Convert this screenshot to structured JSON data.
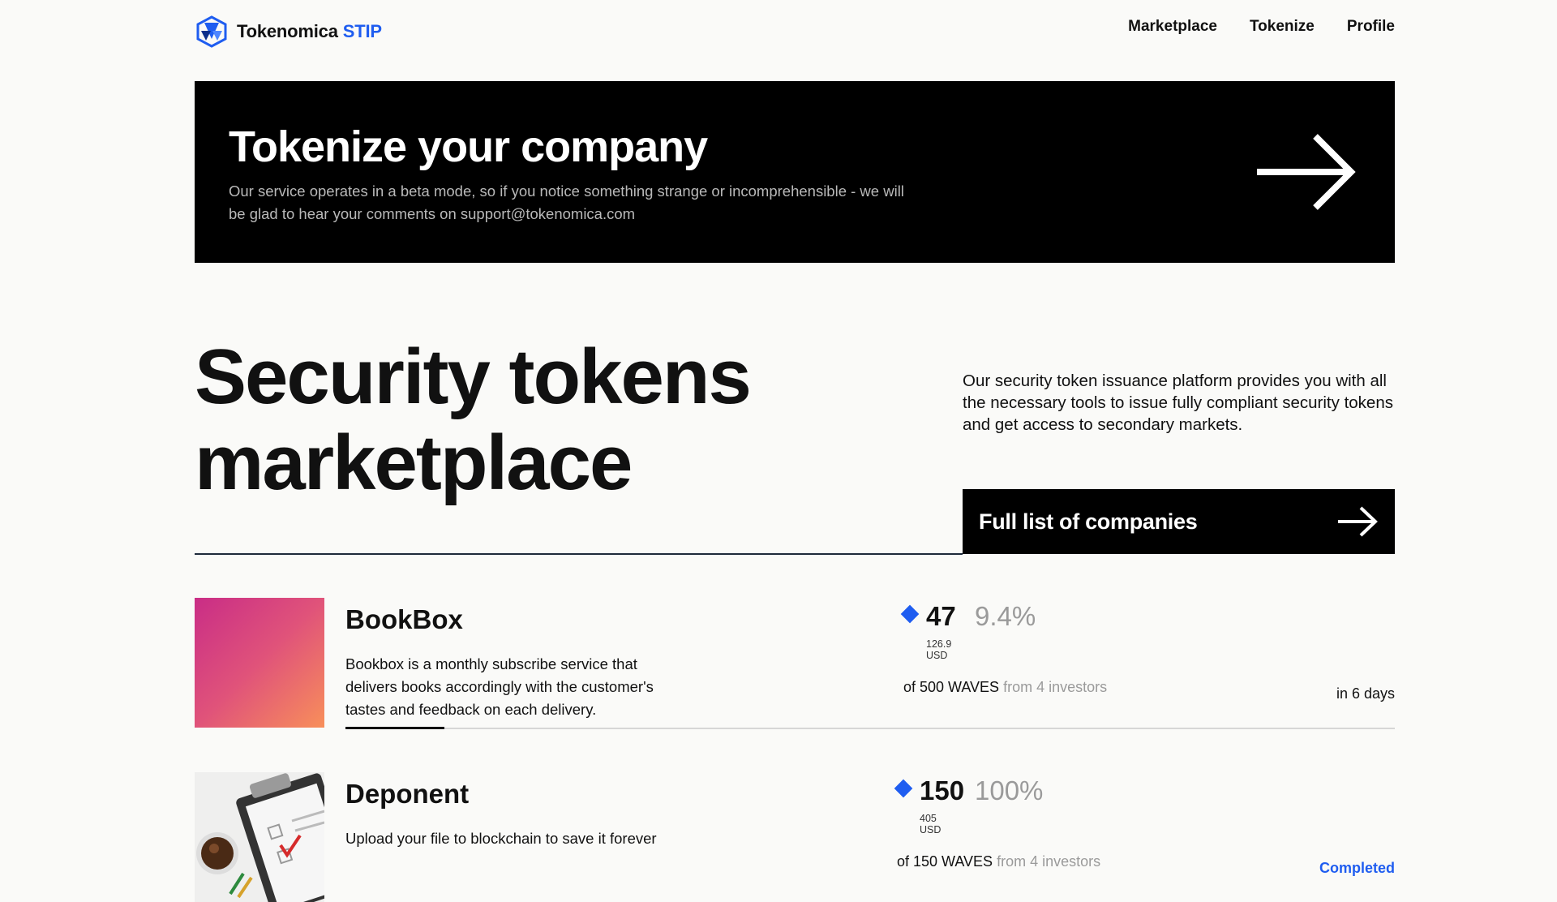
{
  "header": {
    "brand": "Tokenomica",
    "brand_suffix": "STIP",
    "nav": [
      "Marketplace",
      "Tokenize",
      "Profile"
    ]
  },
  "banner": {
    "title": "Tokenize your company",
    "text": "Our service operates in a beta mode, so if you notice something strange or incomprehensible - we will be glad to hear your comments on support@tokenomica.com"
  },
  "hero": {
    "title_line1": "Security tokens",
    "title_line2": "marketplace",
    "description": "Our security token issuance platform provides you with all the necessary tools to issue fully compliant security tokens and get access to secondary markets.",
    "full_list_label": "Full list of companies"
  },
  "companies": [
    {
      "name": "BookBox",
      "description": "Bookbox is a monthly subscribe service that delivers books accordingly with the customer's tastes and feedback on each delivery.",
      "amount": "47",
      "percent": "9.4%",
      "usd": "126.9 USD",
      "of_label": "of 500 WAVES",
      "investors_label": "from 4 investors",
      "due": "in 6 days",
      "progress": 0.094
    },
    {
      "name": "Deponent",
      "description": "Upload your file to blockchain to save it forever",
      "amount": "150",
      "percent": "100%",
      "usd": "405 USD",
      "of_label": "of 150 WAVES",
      "investors_label": "from 4 investors",
      "due": "Completed",
      "progress": 1.0
    }
  ],
  "colors": {
    "accent": "#1f5df0",
    "banner_bg": "#000000",
    "page_bg": "#fafaf8"
  }
}
